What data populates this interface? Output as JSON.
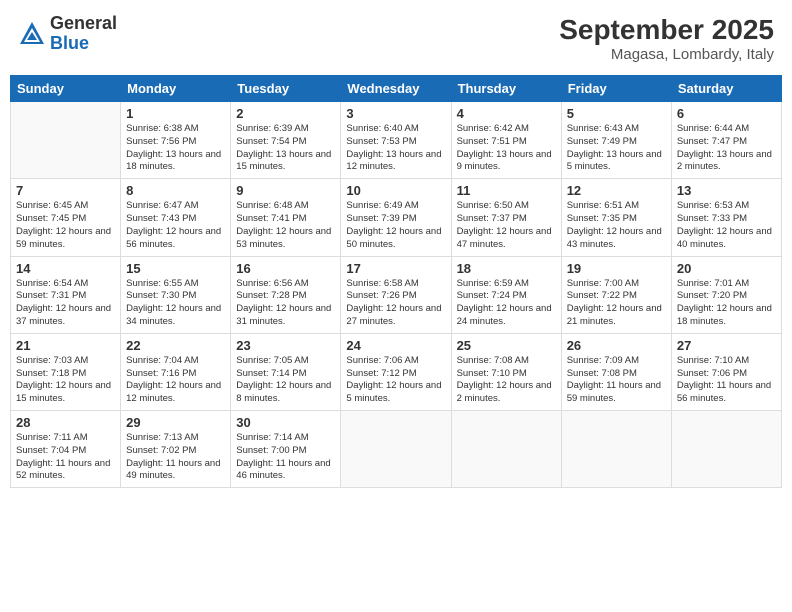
{
  "header": {
    "logo_general": "General",
    "logo_blue": "Blue",
    "month_year": "September 2025",
    "location": "Magasa, Lombardy, Italy"
  },
  "days_of_week": [
    "Sunday",
    "Monday",
    "Tuesday",
    "Wednesday",
    "Thursday",
    "Friday",
    "Saturday"
  ],
  "weeks": [
    [
      {
        "day": "",
        "info": ""
      },
      {
        "day": "1",
        "info": "Sunrise: 6:38 AM\nSunset: 7:56 PM\nDaylight: 13 hours\nand 18 minutes."
      },
      {
        "day": "2",
        "info": "Sunrise: 6:39 AM\nSunset: 7:54 PM\nDaylight: 13 hours\nand 15 minutes."
      },
      {
        "day": "3",
        "info": "Sunrise: 6:40 AM\nSunset: 7:53 PM\nDaylight: 13 hours\nand 12 minutes."
      },
      {
        "day": "4",
        "info": "Sunrise: 6:42 AM\nSunset: 7:51 PM\nDaylight: 13 hours\nand 9 minutes."
      },
      {
        "day": "5",
        "info": "Sunrise: 6:43 AM\nSunset: 7:49 PM\nDaylight: 13 hours\nand 5 minutes."
      },
      {
        "day": "6",
        "info": "Sunrise: 6:44 AM\nSunset: 7:47 PM\nDaylight: 13 hours\nand 2 minutes."
      }
    ],
    [
      {
        "day": "7",
        "info": "Sunrise: 6:45 AM\nSunset: 7:45 PM\nDaylight: 12 hours\nand 59 minutes."
      },
      {
        "day": "8",
        "info": "Sunrise: 6:47 AM\nSunset: 7:43 PM\nDaylight: 12 hours\nand 56 minutes."
      },
      {
        "day": "9",
        "info": "Sunrise: 6:48 AM\nSunset: 7:41 PM\nDaylight: 12 hours\nand 53 minutes."
      },
      {
        "day": "10",
        "info": "Sunrise: 6:49 AM\nSunset: 7:39 PM\nDaylight: 12 hours\nand 50 minutes."
      },
      {
        "day": "11",
        "info": "Sunrise: 6:50 AM\nSunset: 7:37 PM\nDaylight: 12 hours\nand 47 minutes."
      },
      {
        "day": "12",
        "info": "Sunrise: 6:51 AM\nSunset: 7:35 PM\nDaylight: 12 hours\nand 43 minutes."
      },
      {
        "day": "13",
        "info": "Sunrise: 6:53 AM\nSunset: 7:33 PM\nDaylight: 12 hours\nand 40 minutes."
      }
    ],
    [
      {
        "day": "14",
        "info": "Sunrise: 6:54 AM\nSunset: 7:31 PM\nDaylight: 12 hours\nand 37 minutes."
      },
      {
        "day": "15",
        "info": "Sunrise: 6:55 AM\nSunset: 7:30 PM\nDaylight: 12 hours\nand 34 minutes."
      },
      {
        "day": "16",
        "info": "Sunrise: 6:56 AM\nSunset: 7:28 PM\nDaylight: 12 hours\nand 31 minutes."
      },
      {
        "day": "17",
        "info": "Sunrise: 6:58 AM\nSunset: 7:26 PM\nDaylight: 12 hours\nand 27 minutes."
      },
      {
        "day": "18",
        "info": "Sunrise: 6:59 AM\nSunset: 7:24 PM\nDaylight: 12 hours\nand 24 minutes."
      },
      {
        "day": "19",
        "info": "Sunrise: 7:00 AM\nSunset: 7:22 PM\nDaylight: 12 hours\nand 21 minutes."
      },
      {
        "day": "20",
        "info": "Sunrise: 7:01 AM\nSunset: 7:20 PM\nDaylight: 12 hours\nand 18 minutes."
      }
    ],
    [
      {
        "day": "21",
        "info": "Sunrise: 7:03 AM\nSunset: 7:18 PM\nDaylight: 12 hours\nand 15 minutes."
      },
      {
        "day": "22",
        "info": "Sunrise: 7:04 AM\nSunset: 7:16 PM\nDaylight: 12 hours\nand 12 minutes."
      },
      {
        "day": "23",
        "info": "Sunrise: 7:05 AM\nSunset: 7:14 PM\nDaylight: 12 hours\nand 8 minutes."
      },
      {
        "day": "24",
        "info": "Sunrise: 7:06 AM\nSunset: 7:12 PM\nDaylight: 12 hours\nand 5 minutes."
      },
      {
        "day": "25",
        "info": "Sunrise: 7:08 AM\nSunset: 7:10 PM\nDaylight: 12 hours\nand 2 minutes."
      },
      {
        "day": "26",
        "info": "Sunrise: 7:09 AM\nSunset: 7:08 PM\nDaylight: 11 hours\nand 59 minutes."
      },
      {
        "day": "27",
        "info": "Sunrise: 7:10 AM\nSunset: 7:06 PM\nDaylight: 11 hours\nand 56 minutes."
      }
    ],
    [
      {
        "day": "28",
        "info": "Sunrise: 7:11 AM\nSunset: 7:04 PM\nDaylight: 11 hours\nand 52 minutes."
      },
      {
        "day": "29",
        "info": "Sunrise: 7:13 AM\nSunset: 7:02 PM\nDaylight: 11 hours\nand 49 minutes."
      },
      {
        "day": "30",
        "info": "Sunrise: 7:14 AM\nSunset: 7:00 PM\nDaylight: 11 hours\nand 46 minutes."
      },
      {
        "day": "",
        "info": ""
      },
      {
        "day": "",
        "info": ""
      },
      {
        "day": "",
        "info": ""
      },
      {
        "day": "",
        "info": ""
      }
    ]
  ]
}
